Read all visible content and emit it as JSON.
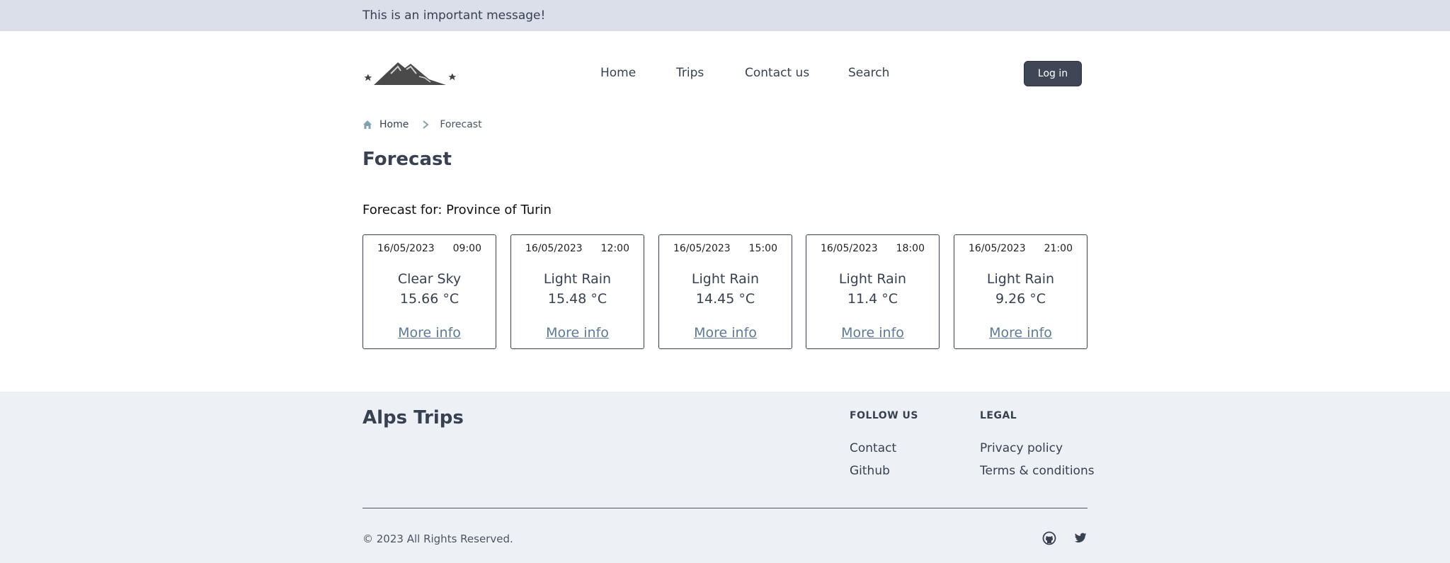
{
  "banner": {
    "text": "This is an important message!"
  },
  "header": {
    "logo_icon": "mountain-logo",
    "nav": [
      {
        "label": "Home"
      },
      {
        "label": "Trips"
      },
      {
        "label": "Contact us"
      },
      {
        "label": "Search"
      }
    ],
    "login_label": "Log in"
  },
  "breadcrumb": {
    "home_icon": "home-icon",
    "home_label": "Home",
    "separator_icon": "chevron-right-icon",
    "current_label": "Forecast"
  },
  "page": {
    "title": "Forecast",
    "forecast_for": "Forecast for: Province of Turin"
  },
  "forecasts": [
    {
      "date": "16/05/2023",
      "time": "09:00",
      "condition": "Clear Sky",
      "temperature": "15.66 °C",
      "link_label": "More info"
    },
    {
      "date": "16/05/2023",
      "time": "12:00",
      "condition": "Light Rain",
      "temperature": "15.48 °C",
      "link_label": "More info"
    },
    {
      "date": "16/05/2023",
      "time": "15:00",
      "condition": "Light Rain",
      "temperature": "14.45 °C",
      "link_label": "More info"
    },
    {
      "date": "16/05/2023",
      "time": "18:00",
      "condition": "Light Rain",
      "temperature": "11.4 °C",
      "link_label": "More info"
    },
    {
      "date": "16/05/2023",
      "time": "21:00",
      "condition": "Light Rain",
      "temperature": "9.26 °C",
      "link_label": "More info"
    }
  ],
  "footer": {
    "brand": "Alps Trips",
    "follow_us": {
      "heading": "FOLLOW US",
      "links": [
        "Contact",
        "Github"
      ]
    },
    "legal": {
      "heading": "LEGAL",
      "links": [
        "Privacy policy",
        "Terms & conditions"
      ]
    },
    "copyright": "© 2023 All Rights Reserved.",
    "social_icons": [
      "github-icon",
      "twitter-icon"
    ]
  },
  "colors": {
    "banner_bg": "#dadfea",
    "footer_bg": "#edf0f5",
    "button_bg": "#3f4757",
    "link": "#5d7a98",
    "breadcrumb_icon": "#7fa3ad"
  }
}
